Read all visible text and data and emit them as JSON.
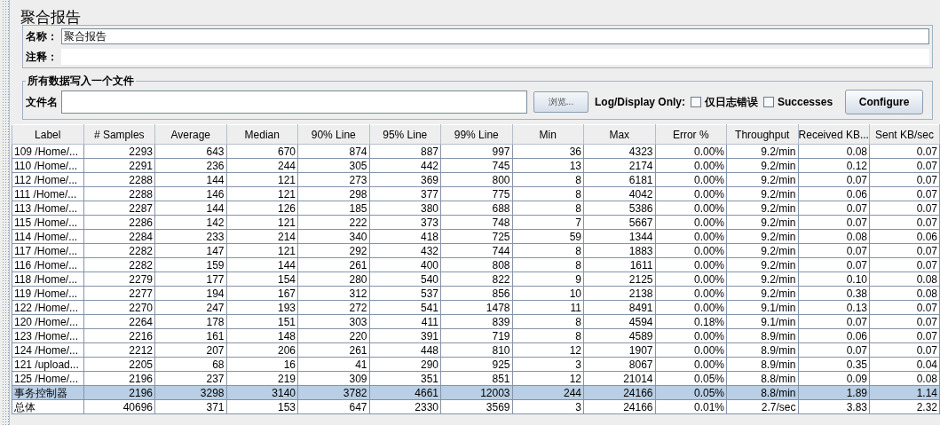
{
  "title": "聚合报告",
  "name_field": {
    "label": "名称：",
    "value": "聚合报告"
  },
  "comment_field": {
    "label": "注释："
  },
  "file_section": {
    "legend": "所有数据写入一个文件",
    "label": "文件名",
    "browse_button": "浏览...",
    "log_display_label": "Log/Display Only:",
    "checkboxes": [
      {
        "label": "仅日志错误",
        "checked": false
      },
      {
        "label": "Successes",
        "checked": false
      }
    ],
    "configure_button": "Configure"
  },
  "table": {
    "columns": [
      "Label",
      "# Samples",
      "Average",
      "Median",
      "90% Line",
      "95% Line",
      "99% Line",
      "Min",
      "Max",
      "Error %",
      "Throughput",
      "Received KB...",
      "Sent KB/sec"
    ],
    "rows": [
      {
        "selected": false,
        "cells": [
          "109 /Home/...",
          "2293",
          "643",
          "670",
          "874",
          "887",
          "997",
          "36",
          "4323",
          "0.00%",
          "9.2/min",
          "0.08",
          "0.07"
        ]
      },
      {
        "selected": false,
        "cells": [
          "110 /Home/...",
          "2291",
          "236",
          "244",
          "305",
          "442",
          "745",
          "13",
          "2174",
          "0.00%",
          "9.2/min",
          "0.12",
          "0.07"
        ]
      },
      {
        "selected": false,
        "cells": [
          "112 /Home/...",
          "2288",
          "144",
          "121",
          "273",
          "369",
          "800",
          "8",
          "6181",
          "0.00%",
          "9.2/min",
          "0.07",
          "0.07"
        ]
      },
      {
        "selected": false,
        "cells": [
          "111 /Home/...",
          "2288",
          "146",
          "121",
          "298",
          "377",
          "775",
          "8",
          "4042",
          "0.00%",
          "9.2/min",
          "0.06",
          "0.07"
        ]
      },
      {
        "selected": false,
        "cells": [
          "113 /Home/...",
          "2287",
          "144",
          "126",
          "185",
          "380",
          "688",
          "8",
          "5386",
          "0.00%",
          "9.2/min",
          "0.07",
          "0.07"
        ]
      },
      {
        "selected": false,
        "cells": [
          "115 /Home/...",
          "2286",
          "142",
          "121",
          "222",
          "373",
          "748",
          "7",
          "5667",
          "0.00%",
          "9.2/min",
          "0.07",
          "0.07"
        ]
      },
      {
        "selected": false,
        "cells": [
          "114 /Home/...",
          "2284",
          "233",
          "214",
          "340",
          "418",
          "725",
          "59",
          "1344",
          "0.00%",
          "9.2/min",
          "0.08",
          "0.06"
        ]
      },
      {
        "selected": false,
        "cells": [
          "117 /Home/...",
          "2282",
          "147",
          "121",
          "292",
          "432",
          "744",
          "8",
          "1883",
          "0.00%",
          "9.2/min",
          "0.07",
          "0.07"
        ]
      },
      {
        "selected": false,
        "cells": [
          "116 /Home/...",
          "2282",
          "159",
          "144",
          "261",
          "400",
          "808",
          "8",
          "1611",
          "0.00%",
          "9.2/min",
          "0.07",
          "0.07"
        ]
      },
      {
        "selected": false,
        "cells": [
          "118 /Home/...",
          "2279",
          "177",
          "154",
          "280",
          "540",
          "822",
          "9",
          "2125",
          "0.00%",
          "9.2/min",
          "0.10",
          "0.08"
        ]
      },
      {
        "selected": false,
        "cells": [
          "119 /Home/...",
          "2277",
          "194",
          "167",
          "312",
          "537",
          "856",
          "10",
          "2138",
          "0.00%",
          "9.2/min",
          "0.38",
          "0.08"
        ]
      },
      {
        "selected": false,
        "cells": [
          "122 /Home/...",
          "2270",
          "247",
          "193",
          "272",
          "541",
          "1478",
          "11",
          "8491",
          "0.00%",
          "9.1/min",
          "0.13",
          "0.07"
        ]
      },
      {
        "selected": false,
        "cells": [
          "120 /Home/...",
          "2264",
          "178",
          "151",
          "303",
          "411",
          "839",
          "8",
          "4594",
          "0.18%",
          "9.1/min",
          "0.07",
          "0.07"
        ]
      },
      {
        "selected": false,
        "cells": [
          "123 /Home/...",
          "2216",
          "161",
          "148",
          "220",
          "391",
          "719",
          "8",
          "4589",
          "0.00%",
          "8.9/min",
          "0.06",
          "0.07"
        ]
      },
      {
        "selected": false,
        "cells": [
          "124 /Home/...",
          "2212",
          "207",
          "206",
          "261",
          "448",
          "810",
          "12",
          "1907",
          "0.00%",
          "8.9/min",
          "0.07",
          "0.07"
        ]
      },
      {
        "selected": false,
        "cells": [
          "121 /upload...",
          "2205",
          "68",
          "16",
          "41",
          "290",
          "925",
          "3",
          "8067",
          "0.00%",
          "8.9/min",
          "0.35",
          "0.04"
        ]
      },
      {
        "selected": false,
        "cells": [
          "125 /Home/...",
          "2196",
          "237",
          "219",
          "309",
          "351",
          "851",
          "12",
          "21014",
          "0.05%",
          "8.8/min",
          "0.09",
          "0.08"
        ]
      },
      {
        "selected": true,
        "cells": [
          "事务控制器",
          "2196",
          "3298",
          "3140",
          "3782",
          "4661",
          "12003",
          "244",
          "24166",
          "0.05%",
          "8.8/min",
          "1.89",
          "1.14"
        ]
      },
      {
        "selected": false,
        "cells": [
          "总体",
          "40696",
          "371",
          "153",
          "647",
          "2330",
          "3569",
          "3",
          "24166",
          "0.01%",
          "2.7/sec",
          "3.83",
          "2.32"
        ]
      }
    ]
  }
}
